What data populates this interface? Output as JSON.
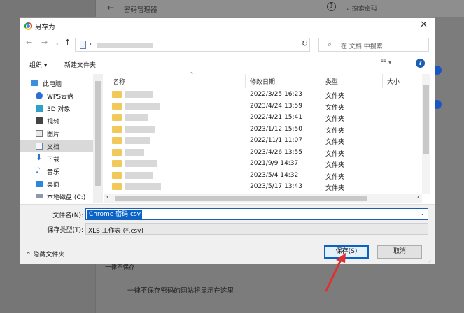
{
  "background": {
    "title": "密码管理器",
    "search_placeholder": "搜索密码",
    "never_saved_heading": "一律不保存",
    "never_saved_empty": "一律不保存密码的网站将显示在这里"
  },
  "dialog": {
    "title": "另存为",
    "search_placeholder": "在 文档 中搜索",
    "organize": "组织 ▾",
    "new_folder": "新建文件夹",
    "nav_items": [
      {
        "label": "此电脑"
      },
      {
        "label": "WPS云盘"
      },
      {
        "label": "3D 对象"
      },
      {
        "label": "视频"
      },
      {
        "label": "图片"
      },
      {
        "label": "文档"
      },
      {
        "label": "下载"
      },
      {
        "label": "音乐"
      },
      {
        "label": "桌面"
      },
      {
        "label": "本地磁盘 (C:)"
      }
    ],
    "columns": {
      "name": "名称",
      "date": "修改日期",
      "type": "类型",
      "size": "大小"
    },
    "rows": [
      {
        "date": "2022/3/25 16:23",
        "type": "文件夹"
      },
      {
        "date": "2023/4/24 13:59",
        "type": "文件夹"
      },
      {
        "date": "2022/4/21 15:41",
        "type": "文件夹"
      },
      {
        "date": "2023/1/12 15:50",
        "type": "文件夹"
      },
      {
        "date": "2022/11/1 11:07",
        "type": "文件夹"
      },
      {
        "date": "2023/4/26 13:55",
        "type": "文件夹"
      },
      {
        "date": "2021/9/9 14:37",
        "type": "文件夹"
      },
      {
        "date": "2023/5/4 14:32",
        "type": "文件夹"
      },
      {
        "date": "2023/5/17 13:43",
        "type": "文件夹"
      }
    ],
    "filename_label": "文件名(N):",
    "filename_value": "Chrome 密码.csv",
    "filetype_label": "保存类型(T):",
    "filetype_value": "XLS 工作表 (*.csv)",
    "hide_folders": "隐藏文件夹",
    "save": "保存(S)",
    "cancel": "取消"
  },
  "colors": {
    "accent": "#0a64c8",
    "arrow": "#e03030",
    "toggle": "#1a56c4"
  }
}
